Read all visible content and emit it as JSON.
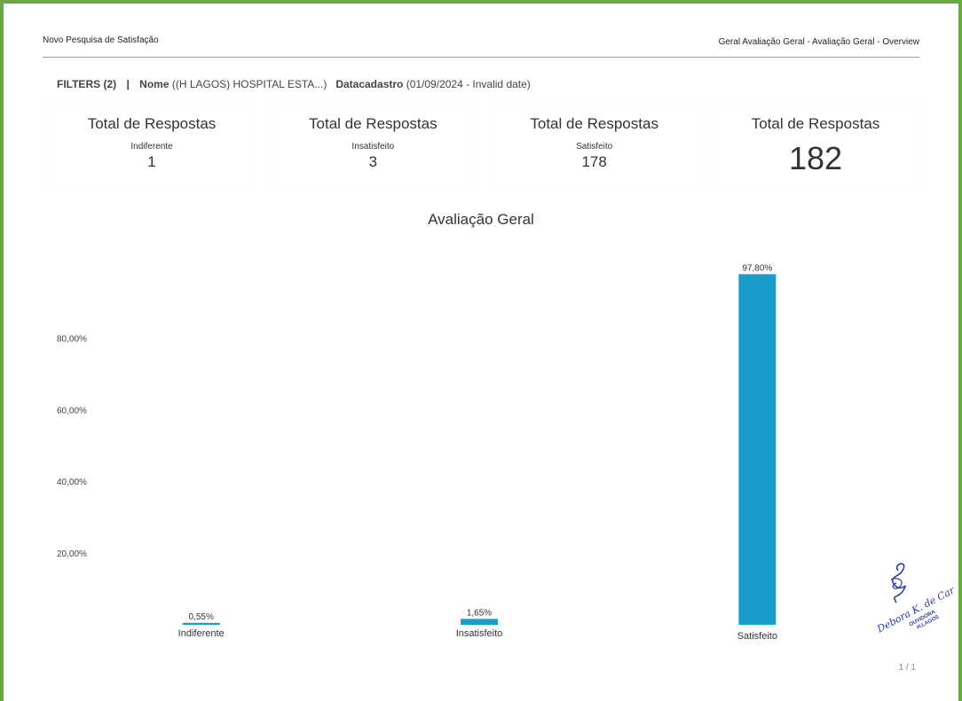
{
  "header": {
    "left_title": "Novo Pesquisa de Satisfação",
    "right_title": "Geral Avaliação Geral - Avaliação Geral - Overview"
  },
  "filters": {
    "count_label": "FILTERS (2)",
    "separator": "|",
    "name_label": "Nome",
    "name_value": "((H LAGOS) HOSPITAL ESTA...)",
    "date_label": "Datacadastro",
    "date_value": "(01/09/2024 - Invalid date)"
  },
  "kpis": [
    {
      "title": "Total de Respostas",
      "subtitle": "Indiferente",
      "value": "1"
    },
    {
      "title": "Total de Respostas",
      "subtitle": "Insatisfeito",
      "value": "3"
    },
    {
      "title": "Total de Respostas",
      "subtitle": "Satisfeito",
      "value": "178"
    },
    {
      "title": "Total de Respostas",
      "subtitle": "",
      "value": "182"
    }
  ],
  "signature": {
    "lines": [
      "Debora K. de Carvalho",
      "OUVIDORA",
      "H.LAGOS"
    ]
  },
  "page": {
    "number": "1 / 1"
  },
  "colors": {
    "frame": "#6aa842",
    "bar": "#1a9ec9"
  },
  "chart_data": {
    "type": "bar",
    "title": "Avaliação Geral",
    "categories": [
      "Indiferente",
      "Insatisfeito",
      "Satisfeito"
    ],
    "values": [
      0.55,
      1.65,
      97.8
    ],
    "data_labels": [
      "0,55%",
      "1,65%",
      "97,80%"
    ],
    "ylim": [
      0,
      110
    ],
    "yticks": [
      20,
      40,
      60,
      80
    ],
    "ytick_labels": [
      "20,00%",
      "40,00%",
      "60,00%",
      "80,00%"
    ],
    "grid": false,
    "legend": "none"
  }
}
